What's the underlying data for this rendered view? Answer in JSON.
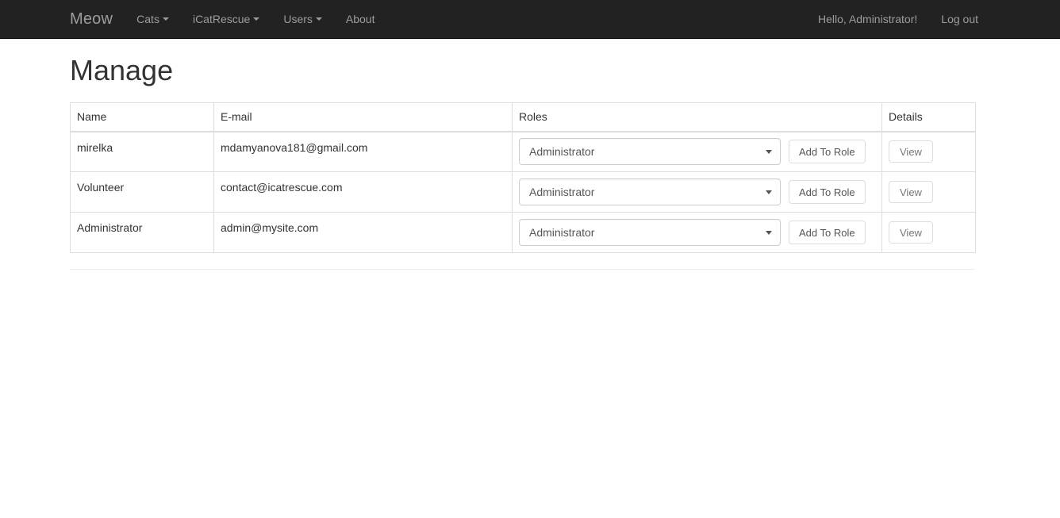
{
  "navbar": {
    "brand": "Meow",
    "left_items": [
      {
        "label": "Cats",
        "has_caret": true,
        "icon": "chevron-down-icon"
      },
      {
        "label": "iCatRescue",
        "has_caret": true,
        "icon": "chevron-down-icon"
      },
      {
        "label": "Users",
        "has_caret": true,
        "icon": "chevron-down-icon"
      },
      {
        "label": "About",
        "has_caret": false,
        "icon": ""
      }
    ],
    "right_items": [
      {
        "label": "Hello, Administrator!"
      },
      {
        "label": "Log out"
      }
    ],
    "background_color": "#222222",
    "link_color": "#9d9d9d"
  },
  "page": {
    "title": "Manage"
  },
  "table": {
    "columns": [
      "Name",
      "E-mail",
      "Roles",
      "Details"
    ],
    "rows": [
      {
        "name": "mirelka",
        "email": "mdamyanova181@gmail.com",
        "role_selected": "Administrator",
        "add_role_label": "Add To Role",
        "view_label": "View"
      },
      {
        "name": "Volunteer",
        "email": "contact@icatrescue.com",
        "role_selected": "Administrator",
        "add_role_label": "Add To Role",
        "view_label": "View"
      },
      {
        "name": "Administrator",
        "email": "admin@mysite.com",
        "role_selected": "Administrator",
        "add_role_label": "Add To Role",
        "view_label": "View"
      }
    ]
  }
}
